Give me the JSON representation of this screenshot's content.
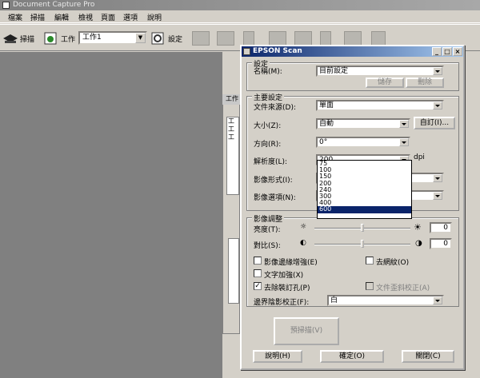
{
  "app": {
    "title": "Document Capture Pro"
  },
  "menu": [
    "檔案",
    "掃描",
    "編輯",
    "檢視",
    "頁面",
    "選項",
    "說明"
  ],
  "toolbar": {
    "scan_label": "掃描",
    "job_label": "工作",
    "job_value": "工作1",
    "settings_label": "設定"
  },
  "behind": {
    "title_frag": "工作",
    "list_frags": [
      "工",
      "工",
      "工"
    ]
  },
  "dialog": {
    "title": "EPSON Scan",
    "settings_group": "設定",
    "name_label": "名稱(M):",
    "name_value": "目前設定",
    "save_button": "儲存",
    "delete_button": "刪除",
    "main_group": "主要設定",
    "source_label": "文件來源(D):",
    "source_value": "單面",
    "size_label": "大小(Z):",
    "size_value": "自動",
    "size_custom_button": "自訂(I)...",
    "orientation_label": "方向(R):",
    "orientation_value": "0°",
    "resolution_label": "解析度(L):",
    "resolution_value": "200",
    "resolution_unit": "dpi",
    "resolution_options": [
      "75",
      "100",
      "150",
      "200",
      "240",
      "300",
      "400",
      "600"
    ],
    "resolution_selected": "600",
    "image_type_label": "影像形式(I):",
    "image_option_label": "影像選項(N):",
    "adjust_group": "影像調整",
    "brightness_label": "亮度(T):",
    "brightness_value": "0",
    "contrast_label": "對比(S):",
    "contrast_value": "0",
    "auto_rotate_label": "影像邊緣增強(E)",
    "remove_bg_label": "去網紋(O)",
    "text_enhance_label": "文字加強(X)",
    "punch_hole_label": "去除裝訂孔(P)",
    "skew_label": "文件歪斜校正(A)",
    "edge_fill_label": "邊界陰影校正(F):",
    "edge_fill_value": "白",
    "scan_button": "預掃描(V)",
    "help_button": "說明(H)",
    "ok_button": "確定(O)",
    "close_button": "關閉(C)"
  }
}
